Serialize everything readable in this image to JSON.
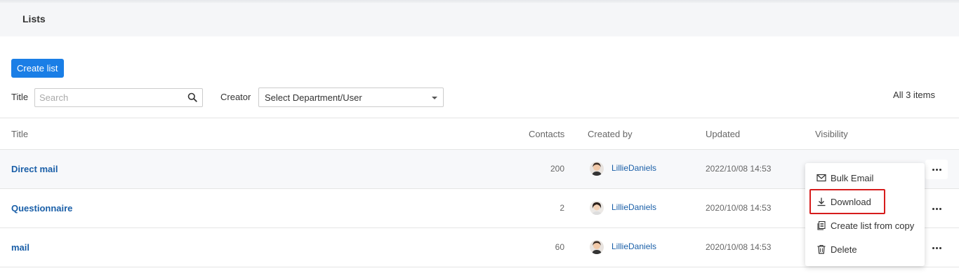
{
  "page": {
    "title": "Lists"
  },
  "toolbar": {
    "create_label": "Create list"
  },
  "filters": {
    "title_label": "Title",
    "search_placeholder": "Search",
    "creator_label": "Creator",
    "creator_value": "Select Department/User"
  },
  "summary": {
    "count_text": "All 3 items"
  },
  "table": {
    "headers": [
      "Title",
      "Contacts",
      "Created by",
      "Updated",
      "Visibility"
    ],
    "rows": [
      {
        "title": "Direct mail",
        "contacts": "200",
        "creator": "LillieDaniels",
        "updated": "2022/10/08 14:53"
      },
      {
        "title": "Questionnaire",
        "contacts": "2",
        "creator": "LillieDaniels",
        "updated": "2020/10/08 14:53"
      },
      {
        "title": "mail",
        "contacts": "60",
        "creator": "LillieDaniels",
        "updated": "2020/10/08 14:53"
      }
    ]
  },
  "menu": {
    "items": [
      "Bulk Email",
      "Download",
      "Create list from copy",
      "Delete"
    ]
  },
  "colors": {
    "accent": "#1a7ee6",
    "link": "#1a5fa8",
    "highlight": "#d61c1c"
  }
}
